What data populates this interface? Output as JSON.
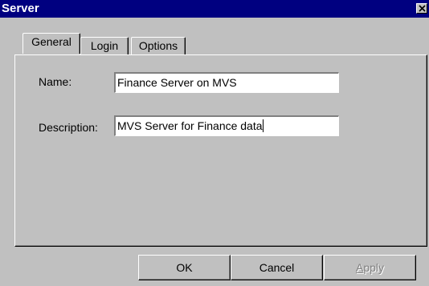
{
  "window": {
    "title": "Server"
  },
  "tabs": [
    {
      "label": "General",
      "active": true
    },
    {
      "label": "Login",
      "active": false
    },
    {
      "label": "Options",
      "active": false
    }
  ],
  "general": {
    "name_label": "Name:",
    "name_value": "Finance Server on MVS",
    "description_label": "Description:",
    "description_value": "MVS Server for Finance data"
  },
  "buttons": {
    "ok": "OK",
    "cancel": "Cancel",
    "apply_first": "A",
    "apply_rest": "pply"
  },
  "colors": {
    "titlebar": "#000080",
    "face": "#c0c0c0",
    "disabled_text": "#808080"
  },
  "icons": {
    "close": "close-icon"
  }
}
